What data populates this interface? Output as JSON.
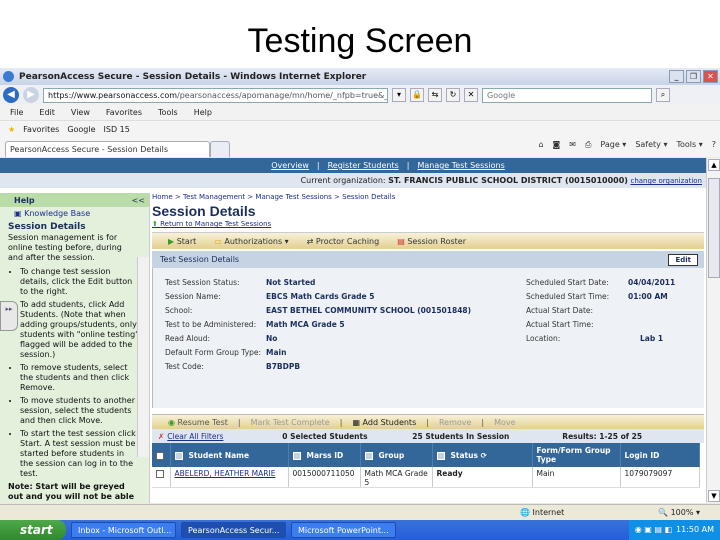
{
  "slide_title": "Testing Screen",
  "window": {
    "title": "PearsonAccess Secure - Session Details - Windows Internet Explorer"
  },
  "address": {
    "url_domain": "https://www.pearsonaccess.com",
    "url_path": "/pearsonaccess/apomanage/mn/home/_nfpb=true&_window.abs",
    "search_placeholder": "Google"
  },
  "menu": [
    "File",
    "Edit",
    "View",
    "Favorites",
    "Tools",
    "Help"
  ],
  "favorites": {
    "label": "Favorites",
    "items": [
      "Google",
      "ISD 15"
    ]
  },
  "browser_tab": {
    "label": "PearsonAccess Secure - Session Details"
  },
  "command_bar": [
    "Page ▾",
    "Safety ▾",
    "Tools ▾"
  ],
  "topnav": [
    "Overview",
    "Register Students",
    "Manage Test Sessions"
  ],
  "org": {
    "label": "Current organization:",
    "name": "ST. FRANCIS PUBLIC SCHOOL DISTRICT (0015010000)",
    "change": "change organization"
  },
  "help": {
    "title": "Help",
    "collapse": "<<",
    "kb": "Knowledge Base",
    "heading": "Session Details",
    "intro": "Session management is for online testing before, during and after the session.",
    "bullets": [
      "To change test session details, click the Edit button to the right.",
      "To add students, click Add Students. (Note that when adding groups/students, only students with \"online testing\" flagged will be added to the session.)",
      "To remove students, select the students and then click Remove.",
      "To move students to another session, select the students and then click Move.",
      "To start the test session click Start. A test session must be started before students in the session can log in to the test."
    ],
    "note": "Note: Start will be greyed out and you will not be able to"
  },
  "breadcrumb": "Home > Test Management > Manage Test Sessions > Session Details",
  "page_title": "Session Details",
  "return_link": "Return to Manage Test Sessions",
  "actions": [
    "Start",
    "Authorizations ▾",
    "Proctor Caching",
    "Session Roster"
  ],
  "details": {
    "header": "Test Session Details",
    "edit": "Edit",
    "left": [
      {
        "label": "Test Session Status:",
        "value": "Not Started"
      },
      {
        "label": "Session Name:",
        "value": "EBCS Math Cards Grade 5"
      },
      {
        "label": "School:",
        "value": "EAST BETHEL COMMUNITY SCHOOL (001501848)"
      },
      {
        "label": "Test to be Administered:",
        "value": "Math MCA Grade 5"
      },
      {
        "label": "Read Aloud:",
        "value": "No"
      },
      {
        "label": "Default Form Group Type:",
        "value": "Main"
      },
      {
        "label": "Test Code:",
        "value": "B7BDPB"
      }
    ],
    "right": [
      {
        "label": "Scheduled Start Date:",
        "value": "04/04/2011"
      },
      {
        "label": "Scheduled Start Time:",
        "value": "01:00 AM"
      },
      {
        "label": "Actual Start Date:",
        "value": ""
      },
      {
        "label": "Actual Start Time:",
        "value": ""
      },
      {
        "label": "Location:",
        "value": "Lab 1"
      }
    ]
  },
  "student_actions": [
    "Resume Test",
    "Mark Test Complete",
    "Add Students",
    "Remove",
    "Move"
  ],
  "filters": {
    "clear": "Clear All Filters",
    "selected": "0 Selected Students",
    "in_session": "25 Students In Session",
    "results": "Results: 1-25 of 25"
  },
  "table": {
    "columns": [
      "Student Name",
      "Marss ID",
      "Group",
      "Status",
      "Form/Form Group Type",
      "Login ID"
    ],
    "refresh": "Refresh",
    "rows": [
      {
        "name": "ABELERD, HEATHER MARIE",
        "marss": "0015000711050",
        "group": "Math MCA Grade 5",
        "status": "Ready",
        "form": "Main",
        "login": "1079079097"
      }
    ]
  },
  "statusbar": {
    "zone": "Internet",
    "zoom": "100%"
  },
  "taskbar": {
    "start": "start",
    "tasks": [
      "Inbox - Microsoft Outl...",
      "PearsonAccess Secur...",
      "Microsoft PowerPoint..."
    ],
    "clock": "11:50 AM"
  }
}
